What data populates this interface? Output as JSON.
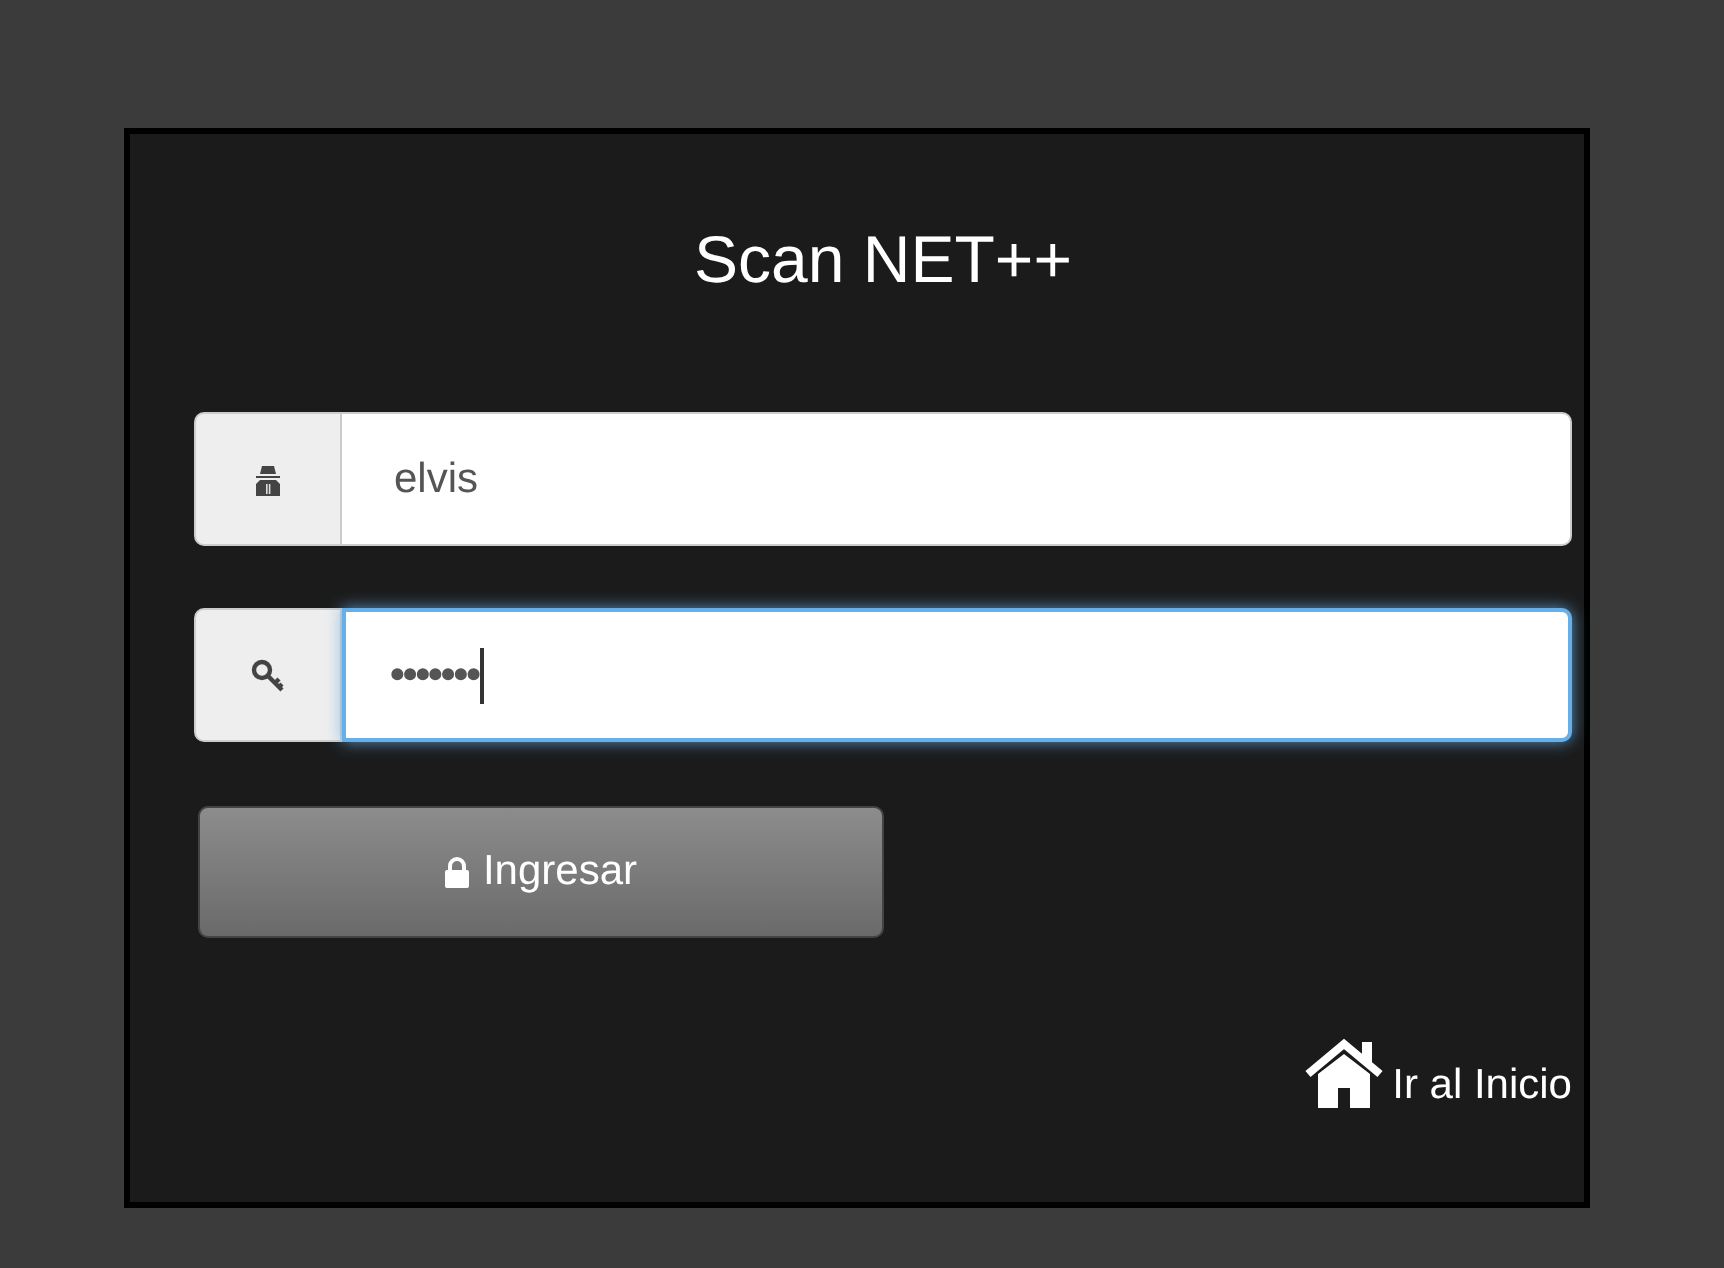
{
  "title": "Scan NET++",
  "fields": [
    {
      "kind": "user",
      "value": "elvis",
      "focused": false
    },
    {
      "kind": "password",
      "value": "•••••••",
      "focused": true
    }
  ],
  "submit_button": {
    "label": "Ingresar"
  },
  "home_link": {
    "label": "Ir al Inicio"
  }
}
